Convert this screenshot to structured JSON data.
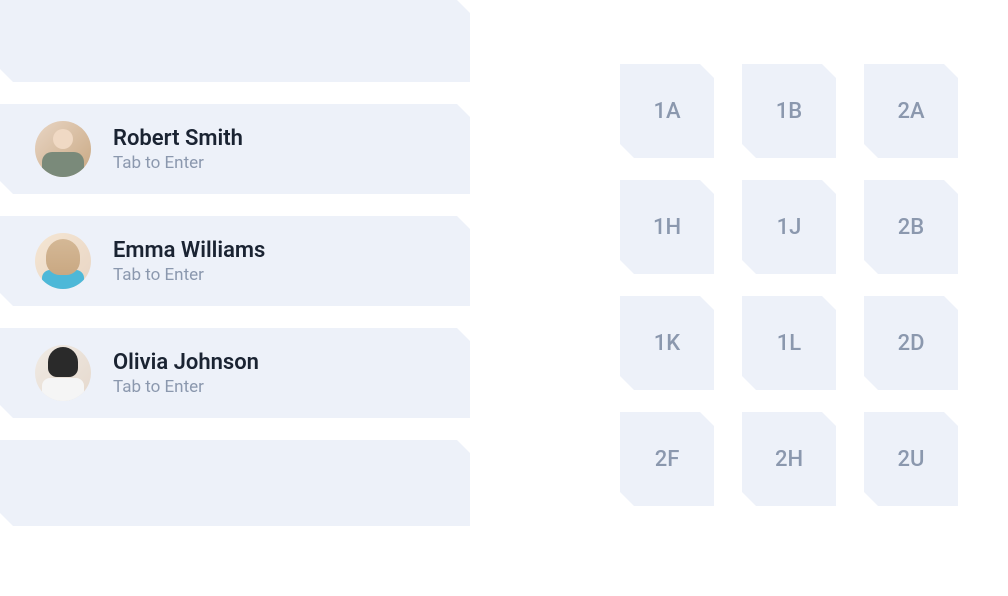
{
  "people": [
    {
      "name": "Robert Smith",
      "hint": "Tab to Enter"
    },
    {
      "name": "Emma Williams",
      "hint": "Tab to Enter"
    },
    {
      "name": "Olivia Johnson",
      "hint": "Tab to Enter"
    }
  ],
  "gridItems": [
    "1A",
    "1B",
    "2A",
    "1H",
    "1J",
    "2B",
    "1K",
    "1L",
    "2D",
    "2F",
    "2H",
    "2U"
  ]
}
